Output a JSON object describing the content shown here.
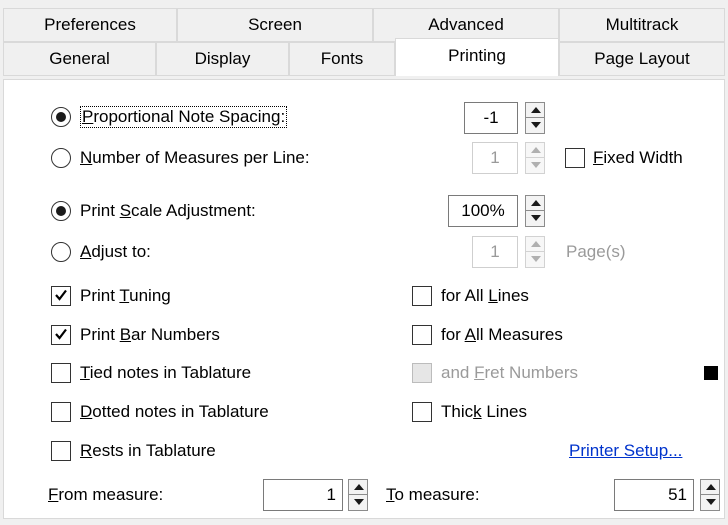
{
  "tabs_back": [
    "Preferences",
    "Screen",
    "Advanced",
    "Multitrack"
  ],
  "tabs_front": [
    "General",
    "Display",
    "Fonts",
    "Printing",
    "Page Layout"
  ],
  "active_tab": "Printing",
  "spacing": {
    "proportional": {
      "label_pre": "",
      "label_u": "P",
      "label_post": "roportional Note Spacing:",
      "value": "-1",
      "checked": true
    },
    "measures": {
      "label_pre": "",
      "label_u": "N",
      "label_post": "umber of Measures per Line:",
      "value": "1",
      "checked": false
    },
    "fixed_width": {
      "label_pre": "",
      "label_u": "F",
      "label_post": "ixed Width",
      "checked": false
    }
  },
  "scale": {
    "print_scale": {
      "label_pre": "Print ",
      "label_u": "S",
      "label_post": "cale Adjustment:",
      "value": "100%",
      "checked": true
    },
    "adjust_to": {
      "label_pre": "",
      "label_u": "A",
      "label_post": "djust to:",
      "value": "1",
      "unit": "Page(s)",
      "checked": false
    }
  },
  "options": {
    "print_tuning": {
      "label_pre": "Print ",
      "label_u": "T",
      "label_post": "uning",
      "checked": true
    },
    "print_bar_numbers": {
      "label_pre": "Print ",
      "label_u": "B",
      "label_post": "ar Numbers",
      "checked": true
    },
    "tied_notes": {
      "label_pre": "",
      "label_u": "T",
      "label_post": "ied notes in Tablature",
      "checked": false
    },
    "dotted_notes": {
      "label_pre": "",
      "label_u": "D",
      "label_post": "otted notes in Tablature",
      "checked": false
    },
    "rests": {
      "label_pre": "",
      "label_u": "R",
      "label_post": "ests in Tablature",
      "checked": false
    },
    "all_lines": {
      "label_pre": "for All ",
      "label_u": "L",
      "label_post": "ines",
      "checked": false
    },
    "all_measures": {
      "label_pre": "for ",
      "label_u": "A",
      "label_post": "ll Measures",
      "checked": false
    },
    "fret_numbers": {
      "label_pre": "and ",
      "label_u": "F",
      "label_post": "ret Numbers",
      "checked": false,
      "disabled": true
    },
    "thick_lines": {
      "label_pre": "Thic",
      "label_u": "k",
      "label_post": " Lines",
      "checked": false
    }
  },
  "printer_setup": "Printer Setup...",
  "range": {
    "from": {
      "label_pre": "",
      "label_u": "F",
      "label_post": "rom measure:",
      "value": "1"
    },
    "to": {
      "label_pre": "",
      "label_u": "T",
      "label_post": "o measure:",
      "value": "51"
    }
  },
  "colors": {
    "link": "#0033cc",
    "panel": "#ffffff",
    "window": "#f0f0f0"
  }
}
